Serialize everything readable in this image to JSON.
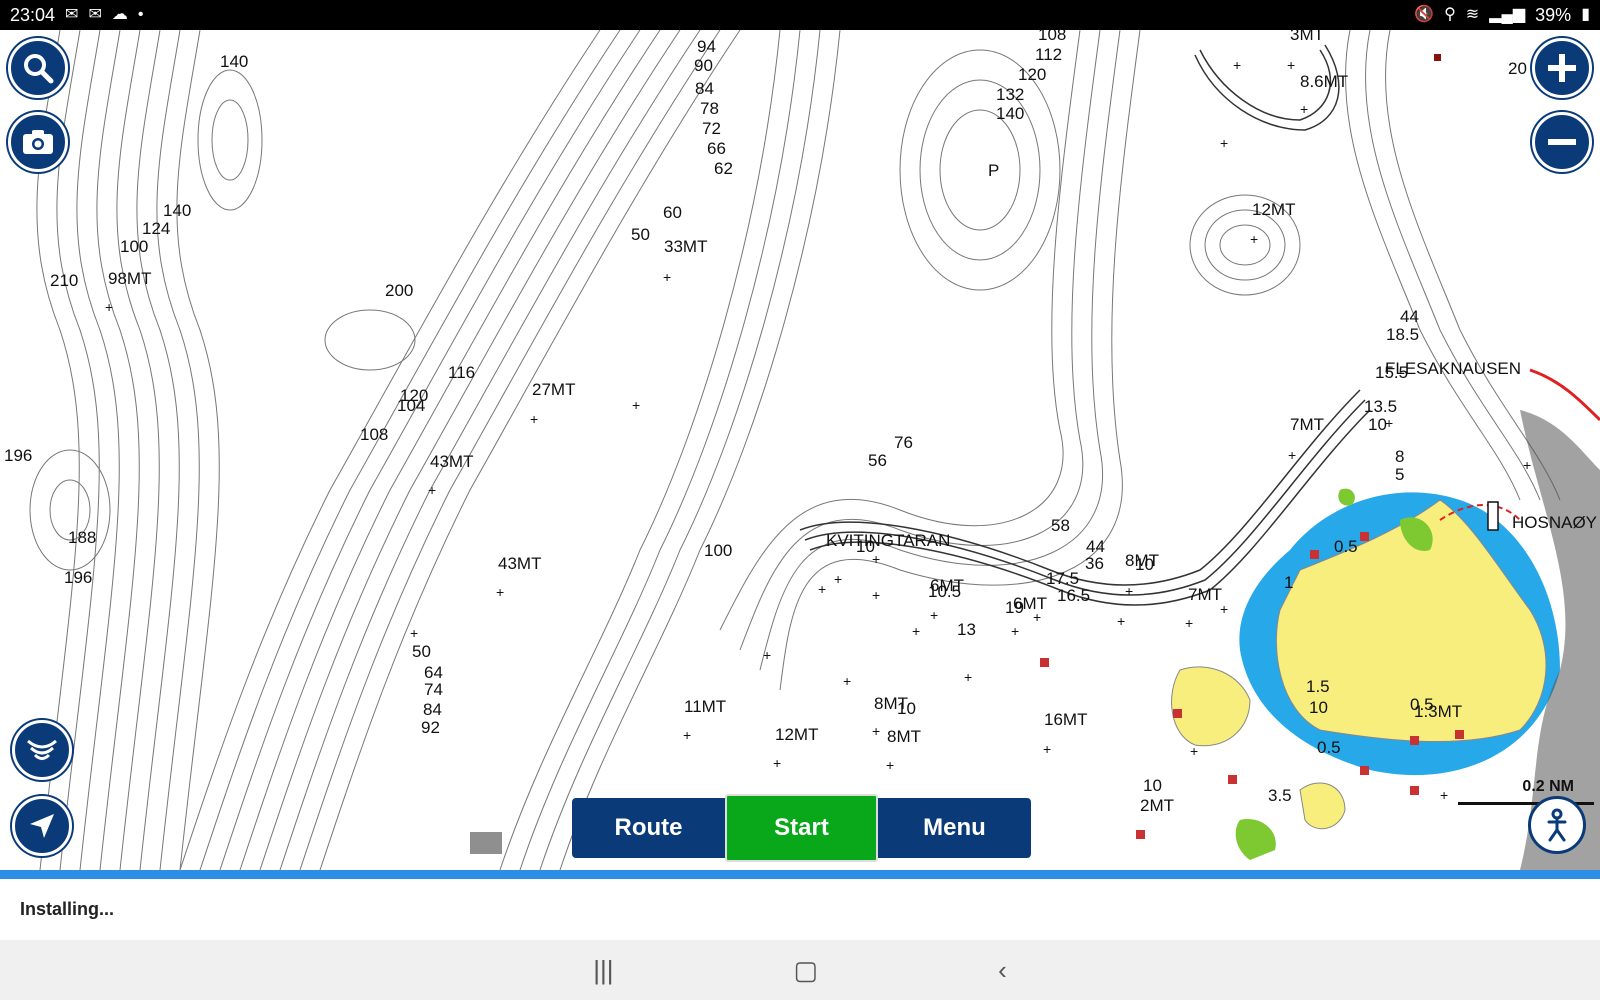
{
  "status": {
    "time": "23:04",
    "battery": "39%"
  },
  "map": {
    "place_names": [
      "KVITINGTARAN",
      "FLESAKNAUSEN",
      "HOSNAØY"
    ],
    "depths": [
      "140",
      "140",
      "124",
      "100",
      "210",
      "98MT",
      "200",
      "94",
      "90",
      "84",
      "78",
      "72",
      "66",
      "62",
      "60",
      "50",
      "33MT",
      "108",
      "112",
      "120",
      "132",
      "140",
      "P",
      "3MT",
      "8.6MT",
      "12MT",
      "44",
      "18.5",
      "116",
      "120",
      "104",
      "27MT",
      "108",
      "43MT",
      "196",
      "188",
      "196",
      "76",
      "56",
      "15.5",
      "7MT",
      "13.5",
      "10",
      "8",
      "5",
      "58",
      "100",
      "10",
      "44",
      "36",
      "8MT",
      "10",
      "6MT",
      "10.5",
      "17.5",
      "16.5",
      "19",
      "6MT",
      "13",
      "7MT",
      "0.5",
      "1",
      "43MT",
      "50",
      "64",
      "74",
      "84",
      "92",
      "11MT",
      "12MT",
      "8MT",
      "10",
      "8MT",
      "16MT",
      "1.5",
      "10",
      "0.5",
      "1.3MT",
      "0.5",
      "10",
      "2MT",
      "3.5",
      "20"
    ],
    "scale_label": "0.2 NM"
  },
  "controls": {
    "search_icon": "search-icon",
    "camera_icon": "camera-icon",
    "zoom_in_icon": "plus-icon",
    "zoom_out_icon": "minus-icon",
    "sonar_icon": "sonar-icon",
    "navigate_icon": "navigation-arrow-icon",
    "person_icon": "person-icon"
  },
  "bottom_bar": {
    "route_label": "Route",
    "start_label": "Start",
    "menu_label": "Menu"
  },
  "install": {
    "text": "Installing..."
  },
  "colors": {
    "brand_blue": "#0a3a78",
    "start_green": "#08a81a",
    "progress_blue": "#2d8ee6",
    "land_yellow": "#f8ee7e",
    "shallow_blue": "#27a8e8"
  }
}
